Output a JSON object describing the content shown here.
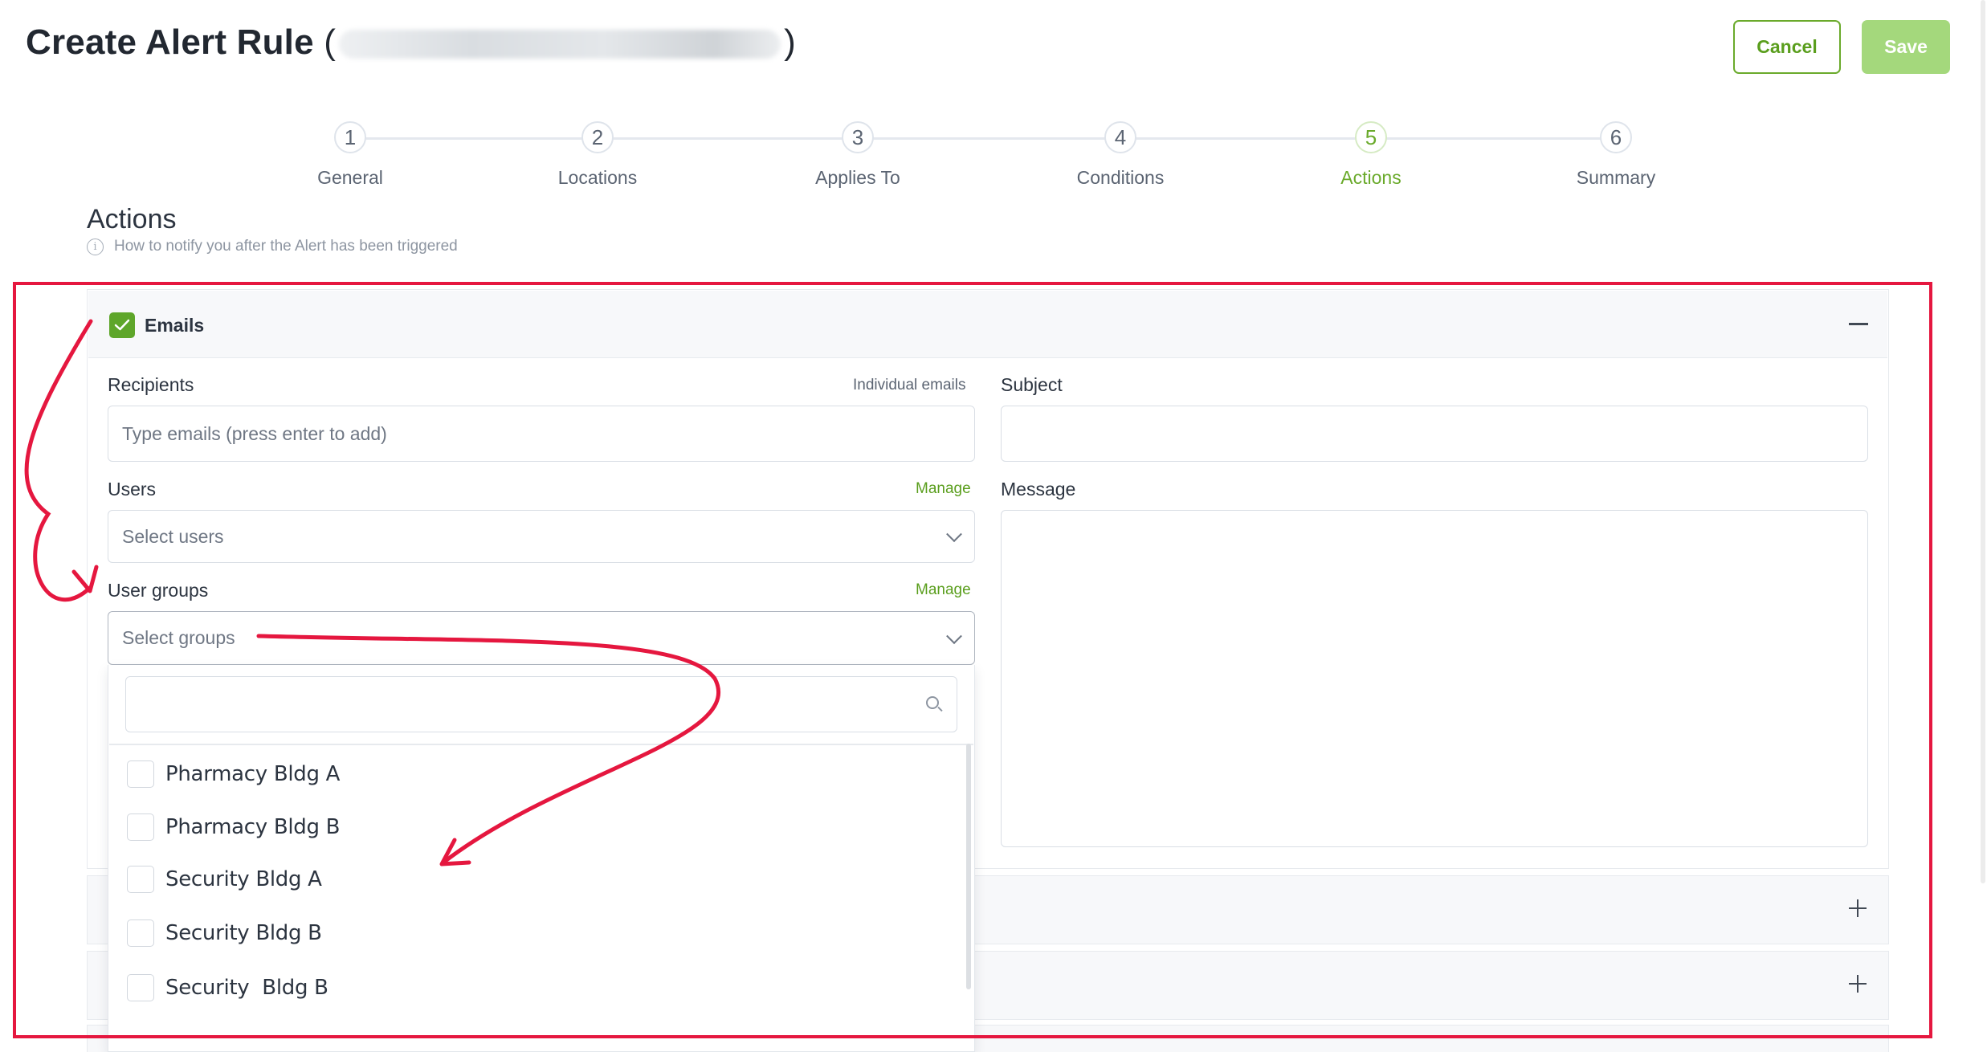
{
  "header": {
    "title": "Create Alert Rule",
    "paren_open": "(",
    "paren_close": ")",
    "cancel_label": "Cancel",
    "save_label": "Save"
  },
  "stepper": {
    "steps": [
      {
        "number": "1",
        "label": "General",
        "active": false
      },
      {
        "number": "2",
        "label": "Locations",
        "active": false
      },
      {
        "number": "3",
        "label": "Applies To",
        "active": false
      },
      {
        "number": "4",
        "label": "Conditions",
        "active": false
      },
      {
        "number": "5",
        "label": "Actions",
        "active": true
      },
      {
        "number": "6",
        "label": "Summary",
        "active": false
      }
    ]
  },
  "section": {
    "title": "Actions",
    "info_icon": "i",
    "subtitle": "How to notify you after the Alert has been triggered"
  },
  "emails_panel": {
    "label": "Emails",
    "checked": true,
    "recipients": {
      "label": "Recipients",
      "aside": "Individual emails",
      "placeholder": "Type emails (press enter to add)"
    },
    "users": {
      "label": "Users",
      "manage": "Manage",
      "placeholder": "Select users"
    },
    "user_groups": {
      "label": "User groups",
      "manage": "Manage",
      "placeholder": "Select groups"
    },
    "subject": {
      "label": "Subject",
      "value": ""
    },
    "message": {
      "label": "Message",
      "value": ""
    }
  },
  "groups_dropdown": {
    "search_value": "",
    "options": [
      {
        "label": "Pharmacy Bldg A",
        "checked": false
      },
      {
        "label": "Pharmacy Bldg B",
        "checked": false
      },
      {
        "label": "Security Bldg A",
        "checked": false
      },
      {
        "label": "Security Bldg B",
        "checked": false
      },
      {
        "label": "Security  Bldg B",
        "checked": false
      }
    ]
  },
  "colors": {
    "accent_green": "#5ea62a",
    "annotation_red": "#e5173f",
    "save_disabled": "#a4d87c"
  }
}
